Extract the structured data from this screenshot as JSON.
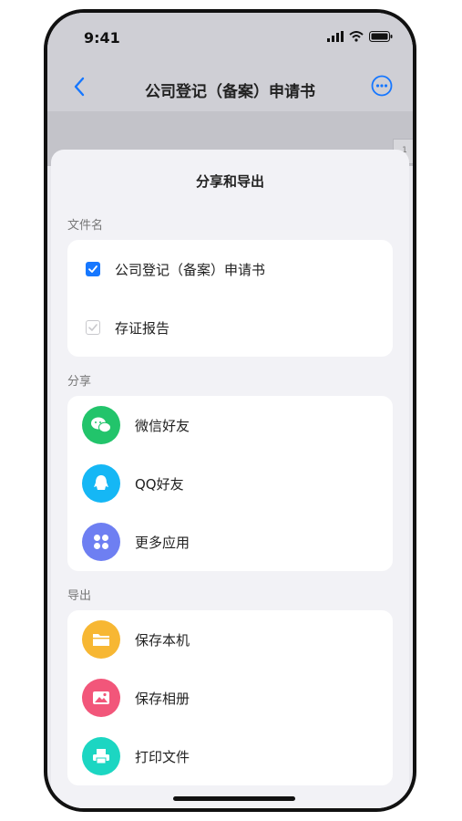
{
  "status": {
    "time": "9:41"
  },
  "nav": {
    "title": "公司登记（备案）申请书",
    "page_num": "1"
  },
  "sheet": {
    "title": "分享和导出",
    "file_section": {
      "label": "文件名",
      "items": [
        {
          "label": "公司登记（备案）申请书",
          "checked": true
        },
        {
          "label": "存证报告",
          "checked": false
        }
      ]
    },
    "share_section": {
      "label": "分享",
      "items": [
        {
          "label": "微信好友",
          "icon": "wechat-icon",
          "color": "#22c46b"
        },
        {
          "label": "QQ好友",
          "icon": "qq-icon",
          "color": "#15b7f5"
        },
        {
          "label": "更多应用",
          "icon": "apps-grid-icon",
          "color": "#6e7ff2"
        }
      ]
    },
    "export_section": {
      "label": "导出",
      "items": [
        {
          "label": "保存本机",
          "icon": "folder-icon",
          "color": "#f7b733"
        },
        {
          "label": "保存相册",
          "icon": "photo-icon",
          "color": "#f2567a"
        },
        {
          "label": "打印文件",
          "icon": "printer-icon",
          "color": "#1cd6c2"
        }
      ]
    }
  },
  "colors": {
    "accent": "#1677ff",
    "sheet_bg": "#f2f2f6",
    "card_bg": "#ffffff"
  }
}
